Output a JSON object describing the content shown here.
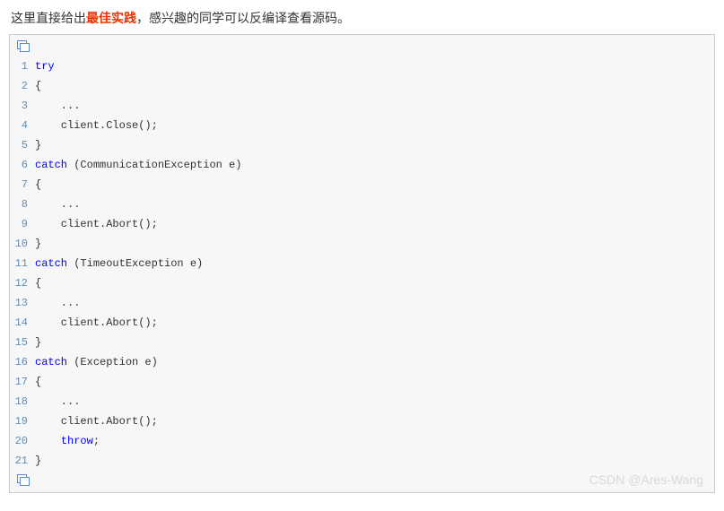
{
  "intro": {
    "pre": "这里直接给出",
    "highlight": "最佳实践",
    "post": "，感兴趣的同学可以反编译查看源码。"
  },
  "code": {
    "lines": [
      {
        "n": 1,
        "segs": [
          {
            "t": "try",
            "k": true
          }
        ]
      },
      {
        "n": 2,
        "segs": [
          {
            "t": "{"
          }
        ]
      },
      {
        "n": 3,
        "segs": [
          {
            "t": "    ..."
          }
        ]
      },
      {
        "n": 4,
        "segs": [
          {
            "t": "    client.Close();"
          }
        ]
      },
      {
        "n": 5,
        "segs": [
          {
            "t": "}"
          }
        ]
      },
      {
        "n": 6,
        "segs": [
          {
            "t": "catch",
            "k": true
          },
          {
            "t": " (CommunicationException e)"
          }
        ]
      },
      {
        "n": 7,
        "segs": [
          {
            "t": "{"
          }
        ]
      },
      {
        "n": 8,
        "segs": [
          {
            "t": "    ..."
          }
        ]
      },
      {
        "n": 9,
        "segs": [
          {
            "t": "    client.Abort();"
          }
        ]
      },
      {
        "n": 10,
        "segs": [
          {
            "t": "}"
          }
        ]
      },
      {
        "n": 11,
        "segs": [
          {
            "t": "catch",
            "k": true
          },
          {
            "t": " (TimeoutException e)"
          }
        ]
      },
      {
        "n": 12,
        "segs": [
          {
            "t": "{"
          }
        ]
      },
      {
        "n": 13,
        "segs": [
          {
            "t": "    ..."
          }
        ]
      },
      {
        "n": 14,
        "segs": [
          {
            "t": "    client.Abort();"
          }
        ]
      },
      {
        "n": 15,
        "segs": [
          {
            "t": "}"
          }
        ]
      },
      {
        "n": 16,
        "segs": [
          {
            "t": "catch",
            "k": true
          },
          {
            "t": " (Exception e)"
          }
        ]
      },
      {
        "n": 17,
        "segs": [
          {
            "t": "{"
          }
        ]
      },
      {
        "n": 18,
        "segs": [
          {
            "t": "    ..."
          }
        ]
      },
      {
        "n": 19,
        "segs": [
          {
            "t": "    client.Abort();"
          }
        ]
      },
      {
        "n": 20,
        "segs": [
          {
            "t": "    "
          },
          {
            "t": "throw",
            "k": true
          },
          {
            "t": ";"
          }
        ]
      },
      {
        "n": 21,
        "segs": [
          {
            "t": "}"
          }
        ]
      }
    ]
  },
  "watermark": "CSDN @Ares-Wang"
}
